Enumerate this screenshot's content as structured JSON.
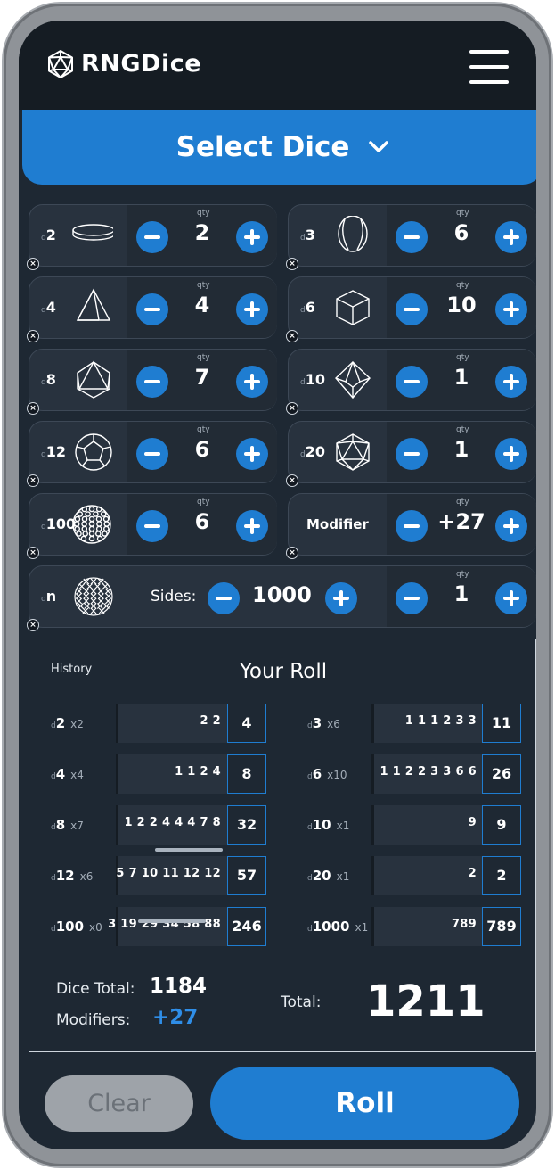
{
  "app": {
    "title": "RNGDice"
  },
  "select_dice": {
    "label": "Select Dice"
  },
  "dice": [
    {
      "prefix": "d",
      "sides": "2",
      "qty_label": "qty",
      "qty": "2"
    },
    {
      "prefix": "d",
      "sides": "3",
      "qty_label": "qty",
      "qty": "6"
    },
    {
      "prefix": "d",
      "sides": "4",
      "qty_label": "qty",
      "qty": "4"
    },
    {
      "prefix": "d",
      "sides": "6",
      "qty_label": "qty",
      "qty": "10"
    },
    {
      "prefix": "d",
      "sides": "8",
      "qty_label": "qty",
      "qty": "7"
    },
    {
      "prefix": "d",
      "sides": "10",
      "qty_label": "qty",
      "qty": "1"
    },
    {
      "prefix": "d",
      "sides": "12",
      "qty_label": "qty",
      "qty": "6"
    },
    {
      "prefix": "d",
      "sides": "20",
      "qty_label": "qty",
      "qty": "1"
    },
    {
      "prefix": "d",
      "sides": "100",
      "qty_label": "qty",
      "qty": "6"
    }
  ],
  "modifier": {
    "label": "Modifier",
    "qty_label": "qty",
    "value": "+27"
  },
  "custom_die": {
    "prefix": "d",
    "sides": "n",
    "sides_label": "Sides:",
    "sides_value": "1000",
    "qty_label": "qty",
    "qty": "1"
  },
  "remove_glyph": "×",
  "results": {
    "history_label": "History",
    "title": "Your Roll",
    "rows": [
      {
        "prefix": "d",
        "die": "2",
        "count": "x2",
        "rolls": "2 2",
        "sum": "4"
      },
      {
        "prefix": "d",
        "die": "3",
        "count": "x6",
        "rolls": "1 1 1 2 3 3",
        "sum": "11"
      },
      {
        "prefix": "d",
        "die": "4",
        "count": "x4",
        "rolls": "1 1 2 4",
        "sum": "8"
      },
      {
        "prefix": "d",
        "die": "6",
        "count": "x10",
        "rolls": "1 1 2 2 3 3 6 6",
        "sum": "26"
      },
      {
        "prefix": "d",
        "die": "8",
        "count": "x7",
        "rolls": "1 2 2 4 4 4 7 8",
        "sum": "32"
      },
      {
        "prefix": "d",
        "die": "10",
        "count": "x1",
        "rolls": "9",
        "sum": "9"
      },
      {
        "prefix": "d",
        "die": "12",
        "count": "x6",
        "rolls": "5 7 10 11 12 12",
        "sum": "57"
      },
      {
        "prefix": "d",
        "die": "20",
        "count": "x1",
        "rolls": "2",
        "sum": "2"
      },
      {
        "prefix": "d",
        "die": "100",
        "count": "x0",
        "rolls": "3 19 29 34 58 88",
        "sum": "246"
      },
      {
        "prefix": "d",
        "die": "1000",
        "count": "x1",
        "rolls": "789",
        "sum": "789"
      }
    ],
    "dice_total_label": "Dice Total:",
    "dice_total": "1184",
    "modifiers_label": "Modifiers:",
    "modifiers": "+27",
    "total_label": "Total:",
    "total": "1211"
  },
  "buttons": {
    "clear": "Clear",
    "roll": "Roll"
  },
  "colors": {
    "accent": "#1f7dd1",
    "background": "#1e2833",
    "header": "#151c23",
    "card": "#28323e"
  }
}
